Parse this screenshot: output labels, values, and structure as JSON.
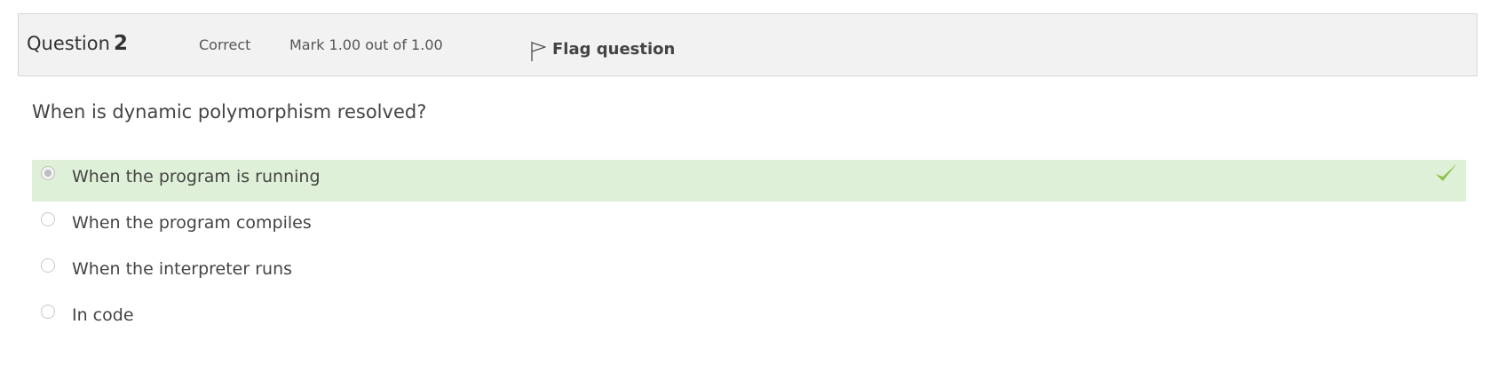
{
  "question": {
    "label": "Question",
    "number": "2",
    "state": "Correct",
    "mark": "Mark 1.00 out of 1.00",
    "flag_label": "Flag question",
    "text": "When is dynamic polymorphism resolved?"
  },
  "answers": [
    {
      "label": "When the program is running",
      "selected": true,
      "correct": true
    },
    {
      "label": "When the program compiles",
      "selected": false,
      "correct": false
    },
    {
      "label": "When the interpreter runs",
      "selected": false,
      "correct": false
    },
    {
      "label": "In code",
      "selected": false,
      "correct": false
    }
  ],
  "colors": {
    "header_bg": "#f2f2f2",
    "correct_bg": "#dff0d8",
    "check": "#8bc34a"
  },
  "icons": {
    "flag": "flag-icon",
    "correct": "check-icon"
  }
}
